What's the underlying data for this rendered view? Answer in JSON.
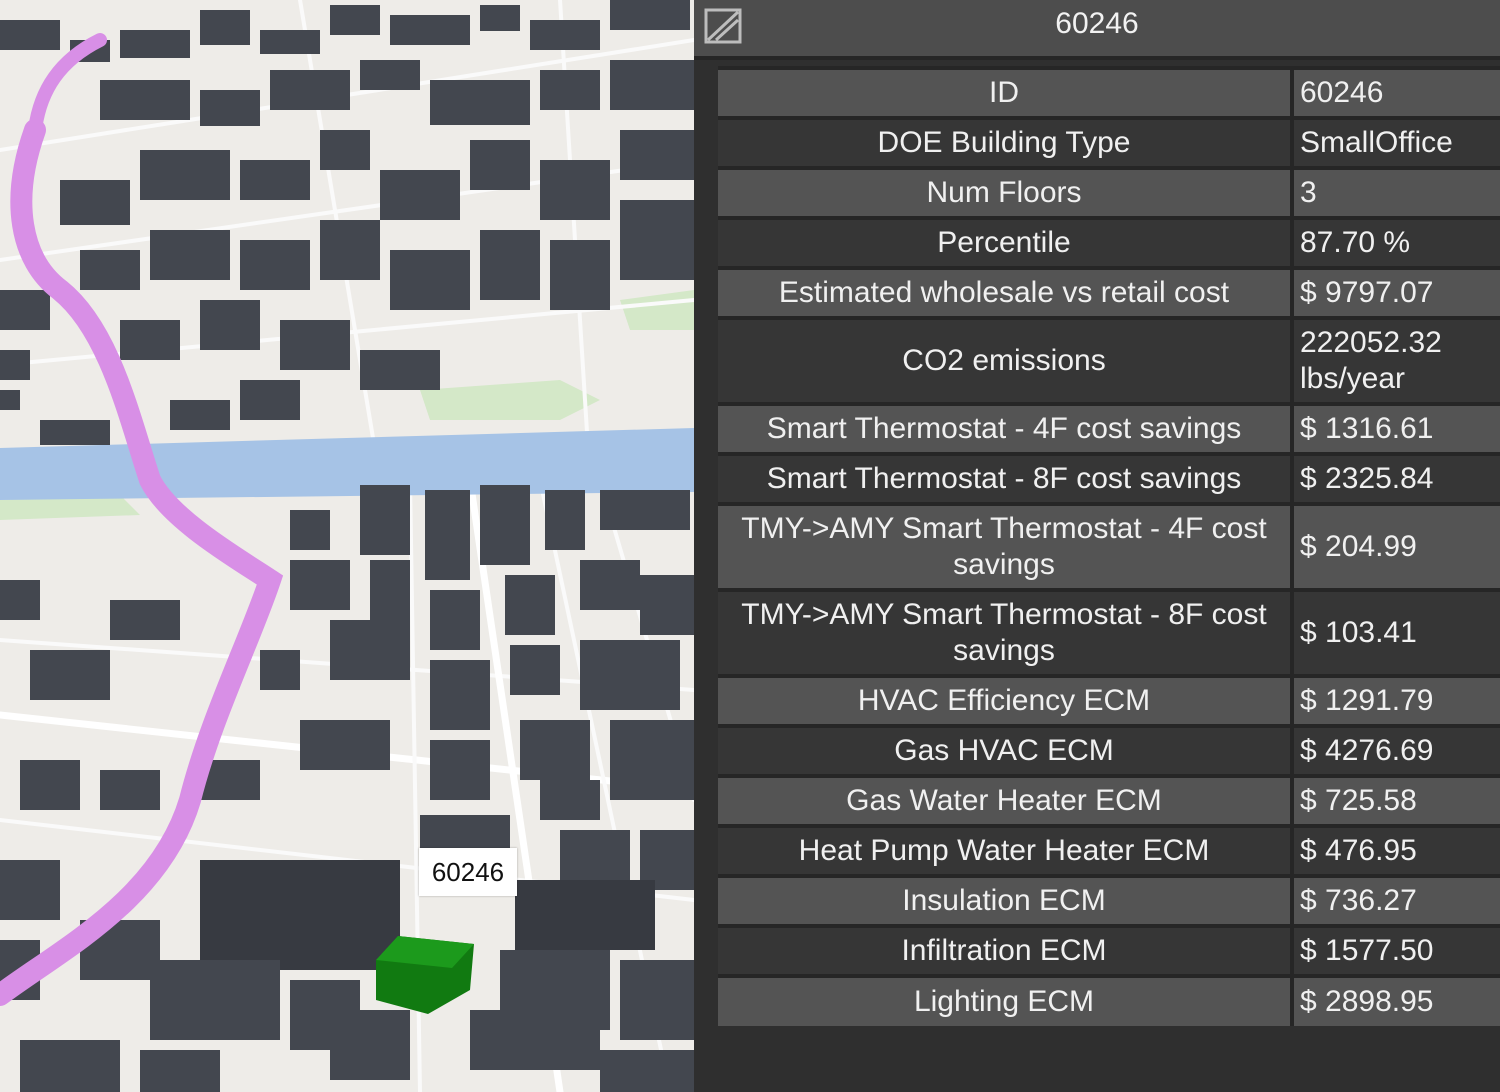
{
  "map": {
    "selected_label": "60246",
    "colors": {
      "background": "#eeece8",
      "building": "#43474f",
      "selected_building": "#117a11",
      "highway": "#d88fe6",
      "river": "#a6c3e6",
      "park": "#d4e8c8"
    }
  },
  "panel": {
    "title": "60246",
    "collapse_icon": "collapse-icon",
    "rows": [
      {
        "label": "ID",
        "value": "60246"
      },
      {
        "label": "DOE Building Type",
        "value": "SmallOffice"
      },
      {
        "label": "Num Floors",
        "value": "3"
      },
      {
        "label": "Percentile",
        "value": "87.70 %"
      },
      {
        "label": "Estimated wholesale vs retail cost",
        "value": "$ 9797.07"
      },
      {
        "label": "CO2 emissions",
        "value": "222052.32 lbs/year"
      },
      {
        "label": "Smart Thermostat - 4F cost savings",
        "value": "$ 1316.61"
      },
      {
        "label": "Smart Thermostat - 8F cost savings",
        "value": "$ 2325.84"
      },
      {
        "label": "TMY->AMY Smart Thermostat - 4F cost savings",
        "value": "$ 204.99"
      },
      {
        "label": "TMY->AMY Smart Thermostat - 8F cost savings",
        "value": "$ 103.41"
      },
      {
        "label": "HVAC Efficiency ECM",
        "value": "$ 1291.79"
      },
      {
        "label": "Gas HVAC ECM",
        "value": "$ 4276.69"
      },
      {
        "label": "Gas Water Heater ECM",
        "value": "$ 725.58"
      },
      {
        "label": "Heat Pump Water Heater ECM",
        "value": "$ 476.95"
      },
      {
        "label": "Insulation ECM",
        "value": "$ 736.27"
      },
      {
        "label": "Infiltration ECM",
        "value": "$ 1577.50"
      },
      {
        "label": "Lighting ECM",
        "value": "$ 2898.95"
      }
    ]
  }
}
